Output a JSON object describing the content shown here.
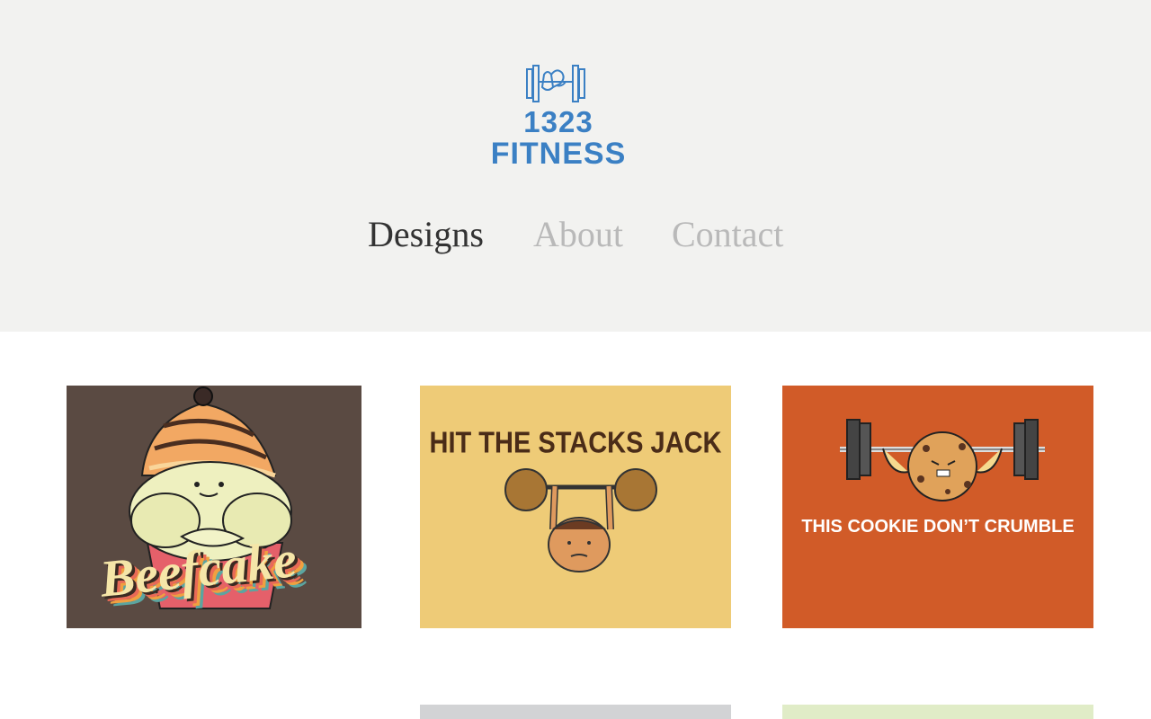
{
  "header": {
    "logo": {
      "line1": "1323",
      "line2": "FITNESS",
      "icon": "dumbbell-hand-icon",
      "color": "#3b80c4"
    },
    "nav": [
      {
        "label": "Designs",
        "active": true
      },
      {
        "label": "About",
        "active": false
      },
      {
        "label": "Contact",
        "active": false
      }
    ],
    "background": "#f2f2f0"
  },
  "designs": [
    {
      "caption": "Beefcake",
      "illustration": "muscular-cupcake-icon",
      "background": "#5a4a42"
    },
    {
      "caption": "HIT THE STACKS JACK",
      "illustration": "pancake-lifting-barbell-icon",
      "background": "#eecb77"
    },
    {
      "caption": "THIS COOKIE DON’T CRUMBLE",
      "illustration": "cookie-lifting-barbell-icon",
      "background": "#d15b28"
    },
    {
      "caption": "",
      "illustration": "",
      "background": "#d2d3d5"
    },
    {
      "caption": "",
      "illustration": "",
      "background": "#e0ecc7"
    }
  ]
}
